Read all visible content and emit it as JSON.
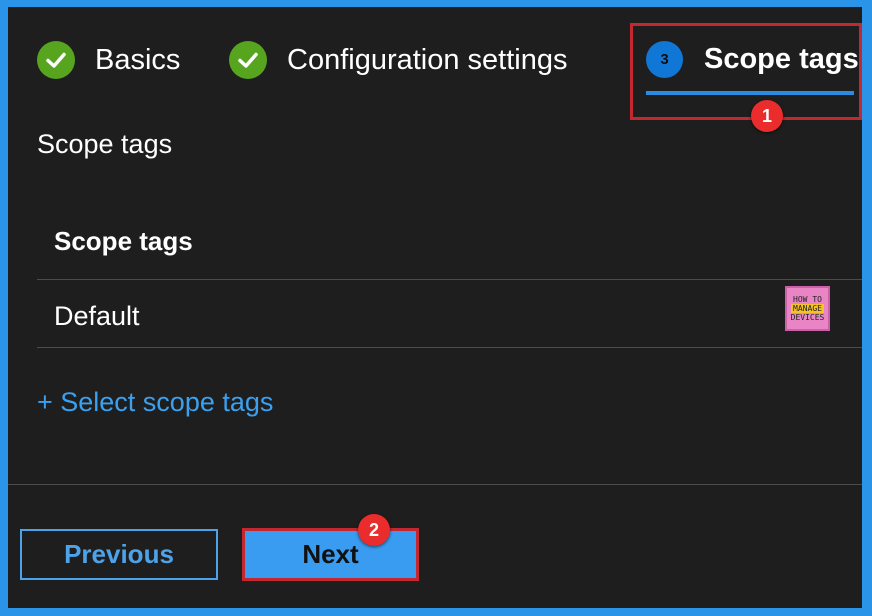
{
  "wizard": {
    "steps": [
      {
        "label": "Basics",
        "state": "complete"
      },
      {
        "label": "Configuration settings",
        "state": "complete"
      },
      {
        "number": "3",
        "label": "Scope tags",
        "state": "active"
      }
    ]
  },
  "annotations": {
    "badge1": "1",
    "badge2": "2",
    "highlight_color": "#c3272f"
  },
  "section": {
    "title": "Scope tags"
  },
  "table": {
    "column_header": "Scope tags",
    "rows": [
      {
        "value": "Default"
      }
    ]
  },
  "logo": {
    "line1": "HOW TO",
    "line2": "MANAGE",
    "line3": "DEVICES"
  },
  "select_link": "+ Select scope tags",
  "footer": {
    "previous_label": "Previous",
    "next_label": "Next"
  },
  "colors": {
    "accent": "#3a9cf0",
    "success": "#57a51f",
    "background": "#1f1e1e",
    "frame": "#2a95e8"
  }
}
